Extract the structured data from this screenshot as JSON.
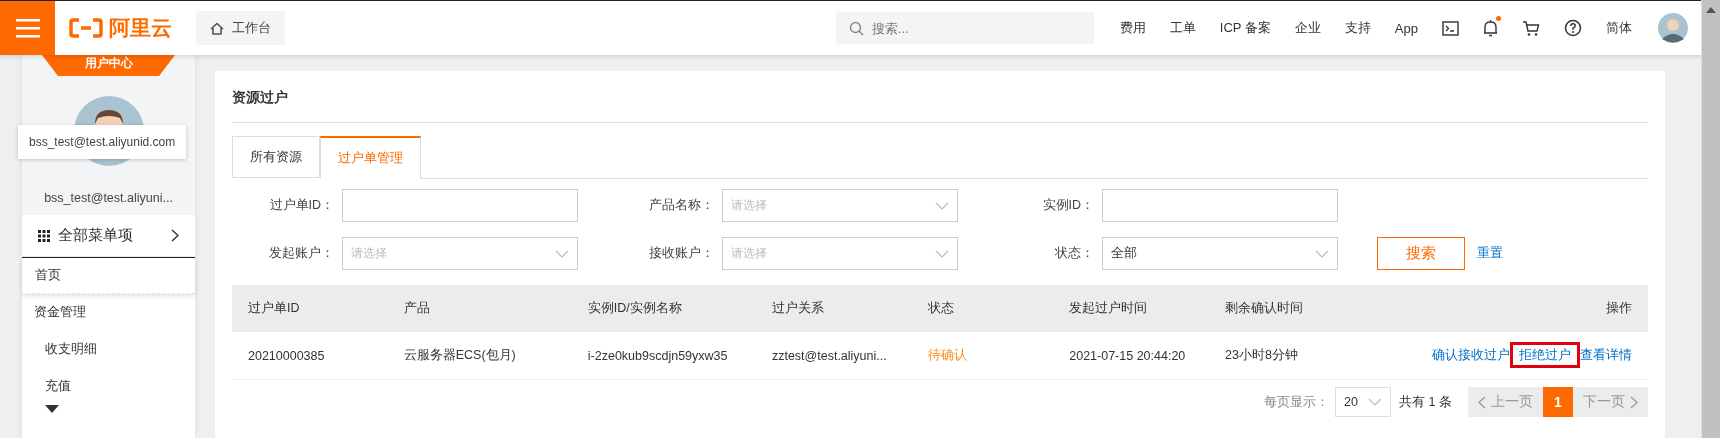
{
  "topbar": {
    "logo": "阿里云",
    "workbench": "工作台",
    "search": {
      "placeholder": "搜索..."
    },
    "nav": [
      "费用",
      "工单",
      "ICP 备案",
      "企业",
      "支持",
      "App"
    ],
    "notification_dot": true,
    "language": "简体"
  },
  "sidebar": {
    "banner": "用户中心",
    "tooltip": "bss_test@test.aliyunid.com",
    "account": "bss_test@test.aliyuni...",
    "all_menu": "全部菜单项",
    "items": [
      {
        "label": "首页",
        "kind": "top"
      },
      {
        "label": "资金管理",
        "kind": "group"
      },
      {
        "label": "收支明细",
        "kind": "sub"
      },
      {
        "label": "充值",
        "kind": "sub"
      }
    ]
  },
  "page": {
    "title": "资源过户",
    "tabs": [
      {
        "label": "所有资源",
        "selected": false
      },
      {
        "label": "过户单管理",
        "selected": true
      }
    ],
    "filters": [
      {
        "label": "过户单ID：",
        "kind": "input"
      },
      {
        "label": "产品名称：",
        "kind": "select",
        "placeholder": "请选择"
      },
      {
        "label": "实例ID：",
        "kind": "input"
      },
      {
        "label": "发起账户：",
        "kind": "select",
        "placeholder": "请选择"
      },
      {
        "label": "接收账户：",
        "kind": "select",
        "placeholder": "请选择"
      },
      {
        "label": "状态：",
        "kind": "select",
        "value": "全部"
      }
    ],
    "search_button": "搜索",
    "reset_link": "重置",
    "table": {
      "columns": [
        "过户单ID",
        "产品",
        "实例ID/实例名称",
        "过户关系",
        "状态",
        "发起过户时间",
        "剩余确认时间",
        "操作"
      ],
      "rows": [
        {
          "id": "20210000385",
          "product": "云服务器ECS(包月)",
          "instance": "i-2ze0kub9scdjn59yxw35",
          "relation": "zztest@test.aliyuni...",
          "status": "待确认",
          "start_time": "2021-07-15 20:44:20",
          "remaining": "23小时8分钟",
          "actions": [
            {
              "label": "确认接收过户",
              "highlighted": false
            },
            {
              "label": "拒绝过户",
              "highlighted": true
            },
            {
              "label": "查看详情",
              "highlighted": false
            }
          ]
        }
      ]
    },
    "pagination": {
      "per_page_label": "每页显示：",
      "per_page": "20",
      "total": "共有 1 条",
      "prev": "上一页",
      "next": "下一页",
      "prev_disabled": true,
      "next_disabled": true,
      "pages": [
        {
          "label": "1",
          "selected": true
        }
      ]
    }
  }
}
